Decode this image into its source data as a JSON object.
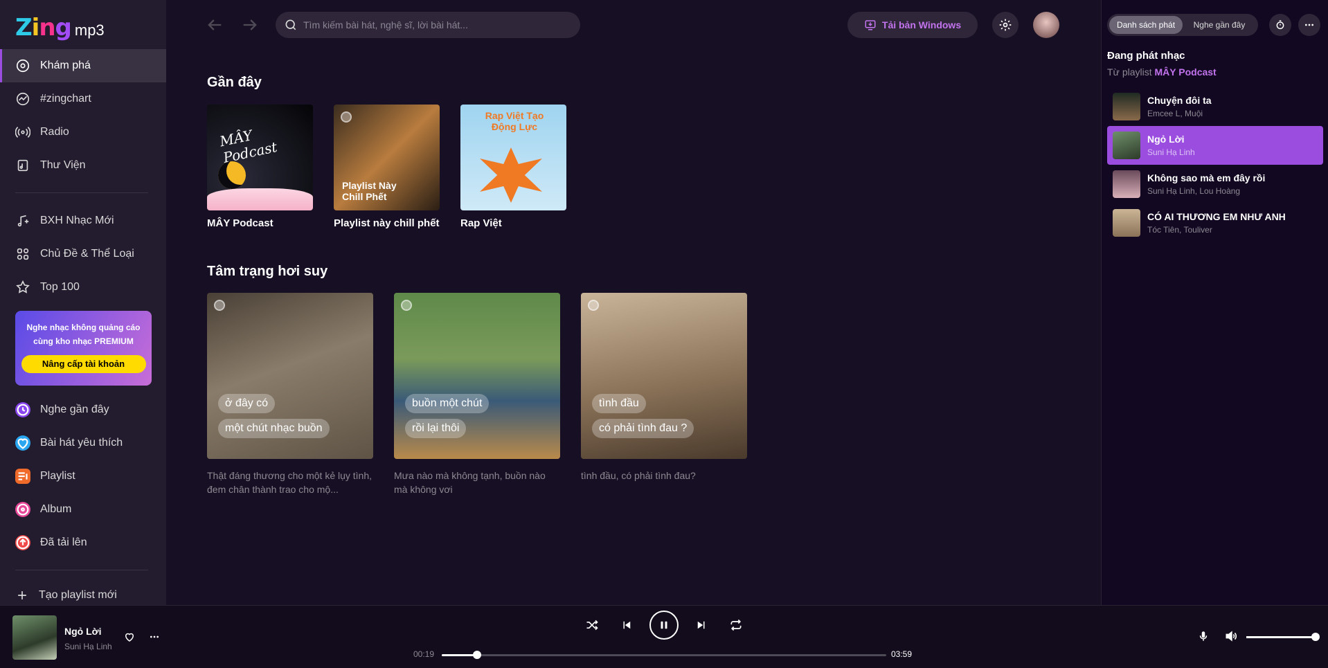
{
  "app": {
    "logo_word": "Zing",
    "logo_suffix": "mp3"
  },
  "sidebar": {
    "items": [
      {
        "label": "Khám phá"
      },
      {
        "label": "#zingchart"
      },
      {
        "label": "Radio"
      },
      {
        "label": "Thư Viện"
      },
      {
        "label": "BXH Nhạc Mới"
      },
      {
        "label": "Chủ Đề & Thể Loại"
      },
      {
        "label": "Top 100"
      },
      {
        "label": "Nghe gần đây"
      },
      {
        "label": "Bài hát yêu thích"
      },
      {
        "label": "Playlist"
      },
      {
        "label": "Album"
      },
      {
        "label": "Đã tải lên"
      }
    ],
    "premium_text": "Nghe nhạc không quảng cáo cùng kho nhạc PREMIUM",
    "premium_button": "Nâng cấp tài khoản",
    "create_playlist": "Tạo playlist mới"
  },
  "header": {
    "search_placeholder": "Tìm kiếm bài hát, nghệ sĩ, lời bài hát...",
    "download_label": "Tải bản Windows"
  },
  "main": {
    "recent_title": "Gần đây",
    "recent": [
      {
        "title": "MÂY Podcast",
        "cover_text": "MÂY Podcast"
      },
      {
        "title": "Playlist này chill phết",
        "cover_text": "Playlist Này Chill Phết"
      },
      {
        "title": "Rap Việt",
        "cover_text": "Rap Việt Tạo Động Lực"
      }
    ],
    "mood_title": "Tâm trạng hơi suy",
    "mood": [
      {
        "bubble1": "ở đây có",
        "bubble2": "một chút nhạc buồn",
        "desc": "Thật đáng thương cho một kẻ lụy tình, đem chân thành trao cho mộ..."
      },
      {
        "bubble1": "buồn một chút",
        "bubble2": "rồi lại thôi",
        "desc": "Mưa nào mà không tạnh, buồn nào mà không vơi"
      },
      {
        "bubble1": "tình đầu",
        "bubble2": "có phải tình đau ?",
        "desc": "tình đầu, có phải tình đau?"
      }
    ]
  },
  "queue": {
    "tab_playing": "Danh sách phát",
    "tab_recent": "Nghe gần đây",
    "now_playing": "Đang phát nhạc",
    "from_label": "Từ playlist",
    "from_playlist": "MÂY Podcast",
    "songs": [
      {
        "title": "Chuyện đôi ta",
        "artist": "Emcee L, Muội"
      },
      {
        "title": "Ngỏ Lời",
        "artist": "Suni Hạ Linh"
      },
      {
        "title": "Không sao mà em đây rồi",
        "artist": "Suni Hạ Linh, Lou Hoàng"
      },
      {
        "title": "CÓ AI THƯƠNG EM NHƯ ANH",
        "artist": "Tóc Tiên, Touliver"
      }
    ]
  },
  "player": {
    "title": "Ngỏ Lời",
    "artist": "Suni Hạ Linh",
    "current_time": "00:19",
    "duration": "03:59",
    "progress": 0.08,
    "volume": 1.0
  },
  "colors": {
    "accent": "#9b4de0",
    "bg": "#170f23",
    "sidebar": "#231b2e",
    "premium_btn": "#ffdb00"
  }
}
